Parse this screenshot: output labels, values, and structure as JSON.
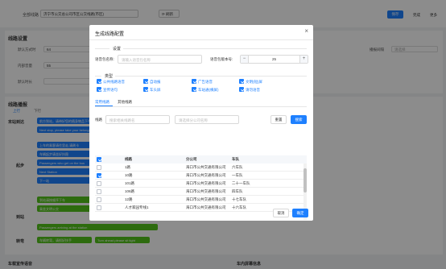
{
  "background": {
    "top": {
      "line_label": "全部线路",
      "line_select": "济宁市公交总公司市区公交线路(市区)",
      "refresh": "刷新",
      "save": "保存",
      "done": "完成",
      "more": "更多"
    },
    "settings_card": {
      "title": "线路设置",
      "fields": [
        {
          "label": "默认方式时",
          "value": "64"
        },
        {
          "label": "内部音量",
          "value": "55"
        },
        {
          "label": "默认时长",
          "value": ""
        }
      ],
      "right_label": "播报间隔",
      "right_value": "请选择"
    },
    "report_card": {
      "title": "线路播报",
      "dir_up": "上行",
      "dir_down": "下行",
      "rows": [
        {
          "label": "末站到达",
          "pills": [
            "前方到站，请带好您的随身物品下车",
            "Next stop, please take your belongings"
          ]
        },
        {
          "label": "起步",
          "pills": [
            "上车的乘客请往里走,请刷卡",
            "车辆起步请坐好扶稳",
            "Passengers who get on the bus",
            "Next Station",
            "下一站"
          ]
        },
        {
          "label": "到站",
          "pills": [
            "到站请按顺序下车",
            "乘坐文明公交",
            "Passengers arriving at the station"
          ]
        },
        {
          "label": "转弯",
          "pills": [
            "车辆转弯，请抓好扶手",
            "Turn ahead please sit tight"
          ]
        }
      ]
    },
    "bottom_left": "车载宣传语音",
    "bottom_right": "车内屏幕信息"
  },
  "modal": {
    "title": "生成线路配置",
    "close": "×",
    "settings_title": "设置",
    "template_label": "语音包名称:",
    "template_placeholder": "请输入语音包名称",
    "version_label": "语音包版本号:",
    "version_value": "25",
    "minus": "−",
    "plus": "+",
    "type_title": "类型",
    "types": [
      {
        "label": "公共线路语音",
        "checked": true
      },
      {
        "label": "自动报",
        "checked": true
      },
      {
        "label": "广告语音",
        "checked": true
      },
      {
        "label": "文明(短)屏",
        "checked": true
      },
      {
        "label": "宣传语句",
        "checked": true
      },
      {
        "label": "车头屏",
        "checked": true
      },
      {
        "label": "车站通(横屏)",
        "checked": true
      },
      {
        "label": "请勿语音",
        "checked": true
      }
    ],
    "tabs": [
      "常用线路",
      "其他线路"
    ],
    "filter": {
      "label": "线路",
      "line_placeholder": "搜索相关线路名",
      "company_placeholder": "请选择分公司名称",
      "reset": "重置",
      "search": "搜索"
    },
    "table": {
      "headers": [
        "线路",
        "分公司",
        "车队"
      ],
      "rows": [
        {
          "checked": false,
          "line": "1路",
          "company": "海口市公共交通有限公司",
          "team": "六车队"
        },
        {
          "checked": true,
          "line": "10路",
          "company": "海口市公共交通有限公司",
          "team": "一车队"
        },
        {
          "checked": false,
          "line": "101路",
          "company": "海口市公共交通有限公司",
          "team": "二十一车队"
        },
        {
          "checked": false,
          "line": "106路",
          "company": "海口市公共交通有限公司",
          "team": "四车队"
        },
        {
          "checked": false,
          "line": "12路",
          "company": "海口市公共交通有限公司",
          "team": "十七车队"
        },
        {
          "checked": false,
          "line": "人才家园专线1",
          "company": "海口市公共交通有限公司",
          "team": "十六车队"
        }
      ]
    },
    "cancel": "取消",
    "confirm": "确定"
  }
}
